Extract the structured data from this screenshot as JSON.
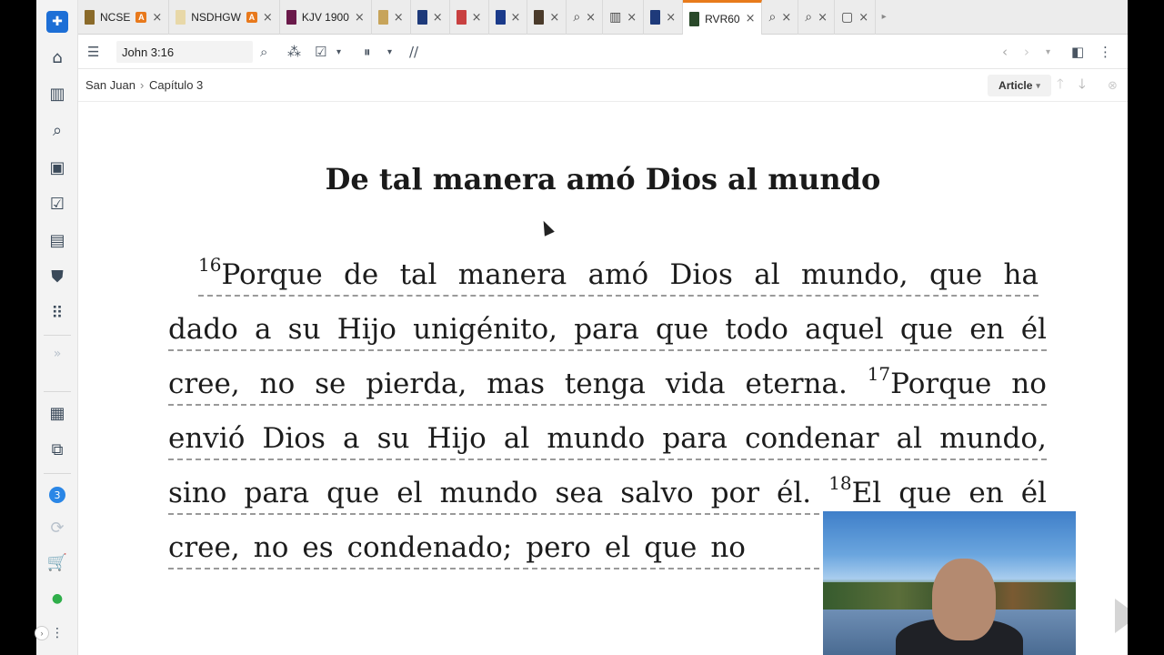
{
  "tabs": [
    {
      "label": "NCSE",
      "cover": "#8a6a2a",
      "tag": "A"
    },
    {
      "label": "NSDHGW",
      "cover": "#e8d8a8",
      "tag": "A"
    },
    {
      "label": "KJV 1900",
      "cover": "#6a1a4a",
      "tag": ""
    },
    {
      "label": "",
      "cover": "#c7a45a",
      "tag": ""
    },
    {
      "label": "",
      "cover": "#1e3a7a",
      "tag": ""
    },
    {
      "label": "",
      "cover": "#c84040",
      "tag": ""
    },
    {
      "label": "",
      "cover": "#1a3a8a",
      "tag": ""
    },
    {
      "label": "",
      "cover": "#4a3a2a",
      "tag": ""
    },
    {
      "label": "",
      "icon": "search-icon",
      "tag": ""
    },
    {
      "label": "",
      "icon": "library-icon",
      "tag": ""
    },
    {
      "label": "",
      "cover": "#1e3a7a",
      "tag": ""
    },
    {
      "label": "RVR60",
      "cover": "#2a4a2a",
      "tag": "",
      "active": true
    },
    {
      "label": "",
      "icon": "search-icon",
      "tag": ""
    },
    {
      "label": "",
      "icon": "search-icon",
      "tag": ""
    },
    {
      "label": "",
      "icon": "chat-icon",
      "tag": ""
    }
  ],
  "toolbar": {
    "reference": "John 3:16"
  },
  "breadcrumb": {
    "book": "San Juan",
    "separator": "›",
    "chapter": "Capítulo 3"
  },
  "view_mode": "Article",
  "sidebar_badge": "3",
  "article": {
    "heading": "De tal manera amó Dios al mundo",
    "lines": [
      {
        "words": [
          "¹⁶Porque",
          "de",
          "tal",
          "manera",
          "amó",
          "Dios",
          "al",
          "mundo,",
          "que",
          "ha"
        ]
      },
      {
        "words": [
          "dado",
          "a",
          "su",
          "Hijo",
          "unigénito,",
          "para",
          "que",
          "todo",
          "aquel",
          "que",
          "en",
          "él"
        ]
      },
      {
        "words": [
          "cree,",
          "no",
          "se",
          "pierda,",
          "mas",
          "tenga",
          "vida",
          "eterna.",
          "¹⁷Porque",
          "no"
        ]
      },
      {
        "words": [
          "envió",
          "Dios",
          "a",
          "su",
          "Hijo",
          "al",
          "mundo",
          "para",
          "condenar",
          "al",
          "mundo,"
        ]
      },
      {
        "words": [
          "sino",
          "para",
          "que",
          "el",
          "mundo",
          "sea",
          "salvo",
          "por",
          "él.",
          "¹⁸El",
          "que",
          "en",
          "él"
        ]
      },
      {
        "words": [
          "cree,",
          "no",
          "es",
          "condenado;",
          "pero",
          "el",
          "que",
          "no"
        ]
      }
    ]
  }
}
